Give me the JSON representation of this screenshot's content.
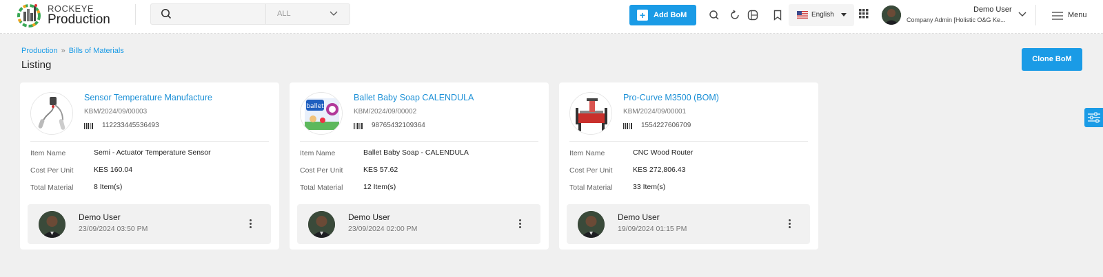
{
  "header": {
    "brand_top": "ROCKEYE",
    "brand_main": "Production",
    "search_placeholder": "",
    "search_scope": "ALL",
    "add_bom_label": "Add BoM",
    "language": "English",
    "user_name": "Demo User",
    "user_role": "Company Admin [Holistic O&G Ke...",
    "menu_label": "Menu"
  },
  "breadcrumb": [
    "Production",
    "Bills of Materials"
  ],
  "page_title": "Listing",
  "clone_bom_label": "Clone BoM",
  "field_labels": {
    "item_name": "Item Name",
    "cost_per_unit": "Cost Per Unit",
    "total_material": "Total Material"
  },
  "cards": [
    {
      "title": "Sensor Temperature Manufacture",
      "code": "KBM/2024/09/00003",
      "barcode": "112233445536493",
      "item_name": "Semi - Actuator Temperature Sensor",
      "cost_per_unit": "KES 160.04",
      "total_material": "8 Item(s)",
      "user": "Demo User",
      "date": "23/09/2024 03:50 PM",
      "image": "temperature-sensor-image"
    },
    {
      "title": "Ballet Baby Soap CALENDULA",
      "code": "KBM/2024/09/00002",
      "barcode": "98765432109364",
      "item_name": "Ballet Baby Soap - CALENDULA",
      "cost_per_unit": "KES 57.62",
      "total_material": "12 Item(s)",
      "user": "Demo User",
      "date": "23/09/2024 02:00 PM",
      "image": "baby-soap-image"
    },
    {
      "title": "Pro-Curve M3500 (BOM)",
      "code": "KBM/2024/09/00001",
      "barcode": "1554227606709",
      "item_name": "CNC Wood Router",
      "cost_per_unit": "KES 272,806.43",
      "total_material": "33 Item(s)",
      "user": "Demo User",
      "date": "19/09/2024 01:15 PM",
      "image": "cnc-router-image"
    }
  ],
  "colors": {
    "accent": "#1a9be6",
    "link": "#1a8fd6",
    "page_bg": "#f0f0f0"
  }
}
